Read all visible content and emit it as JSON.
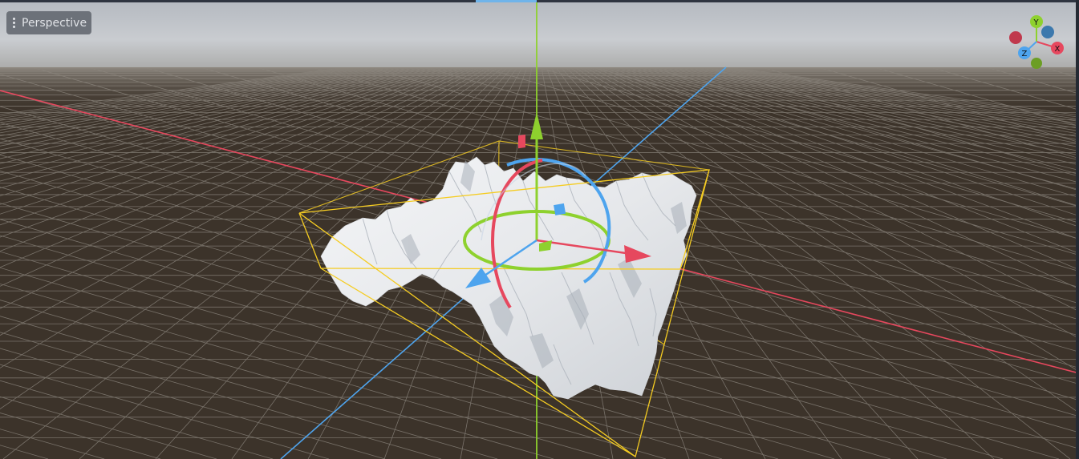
{
  "viewport": {
    "view_menu_label": "Perspective",
    "menu_icon": "kebab-menu-icon"
  },
  "axis_gizmo": {
    "x_label": "X",
    "y_label": "Y",
    "z_label": "Z"
  },
  "colors": {
    "x_axis": "#e6485e",
    "y_axis": "#8ed12e",
    "z_axis": "#4ea4ee",
    "selection_box": "#f5cc22",
    "grid_floor": "#3c332a",
    "sky_top": "#b7bcc2",
    "terrain": "#e9ebee",
    "active_tab_accent": "#6fb4ea"
  }
}
